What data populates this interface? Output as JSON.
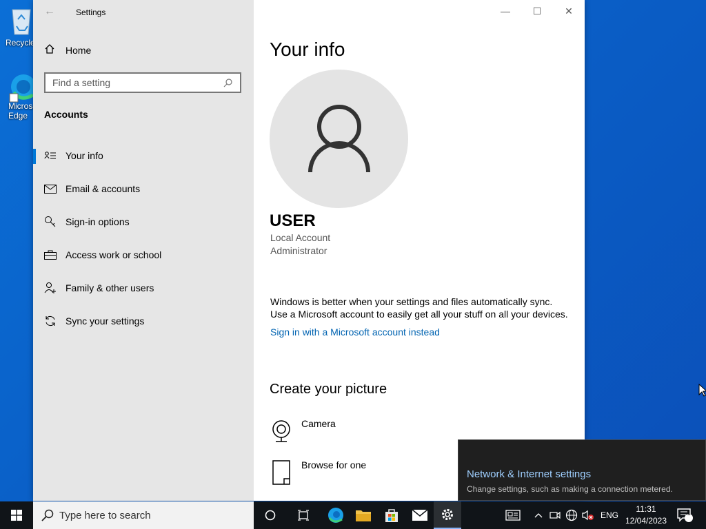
{
  "desktop": {
    "icons": [
      {
        "label": "Recycle Bin"
      },
      {
        "label": "Microsoft Edge"
      }
    ]
  },
  "window": {
    "title": "Settings"
  },
  "sidebar": {
    "home": "Home",
    "search_placeholder": "Find a setting",
    "section": "Accounts",
    "items": [
      {
        "label": "Your info",
        "icon": "contact-info-icon",
        "active": true
      },
      {
        "label": "Email & accounts",
        "icon": "mail-icon"
      },
      {
        "label": "Sign-in options",
        "icon": "key-icon"
      },
      {
        "label": "Access work or school",
        "icon": "briefcase-icon"
      },
      {
        "label": "Family & other users",
        "icon": "add-user-icon"
      },
      {
        "label": "Sync your settings",
        "icon": "sync-icon"
      }
    ]
  },
  "main": {
    "title": "Your info",
    "user_name": "USER",
    "account_type": "Local Account",
    "role": "Administrator",
    "sync_line1": "Windows is better when your settings and files automatically sync.",
    "sync_line2": "Use a Microsoft account to easily get all your stuff on all your devices.",
    "sign_in_link": "Sign in with a Microsoft account instead",
    "picture_heading": "Create your picture",
    "options": [
      {
        "label": "Camera",
        "icon": "camera-icon"
      },
      {
        "label": "Browse for one",
        "icon": "browse-file-icon"
      }
    ]
  },
  "toast": {
    "title": "Network & Internet settings",
    "body": "Change settings, such as making a connection metered."
  },
  "taskbar": {
    "search_placeholder": "Type here to search",
    "language": "ENG",
    "time": "11:31",
    "date": "12/04/2023",
    "notification_count": "1"
  },
  "colors": {
    "accent": "#0078d7",
    "link": "#0063b1",
    "desktop": "#0b5fc7",
    "taskbar": "#101418"
  }
}
